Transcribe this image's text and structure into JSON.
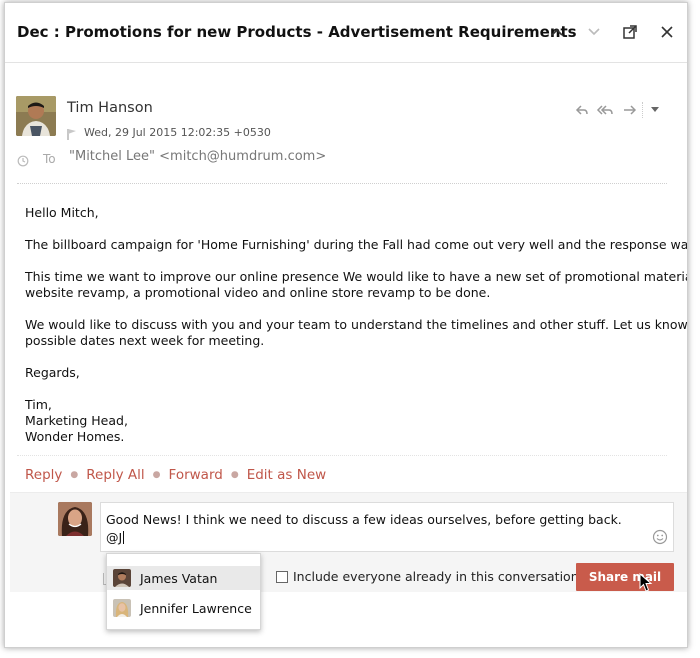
{
  "header": {
    "subject": "Dec : Promotions for new Products - Advertisement Requirements"
  },
  "message": {
    "sender_name": "Tim Hanson",
    "date": "Wed, 29 Jul 2015 12:02:35 +0530",
    "to_label": "To",
    "to_value": "\"Mitchel Lee\" <mitch@humdrum.com>",
    "body": {
      "greeting": "Hello Mitch,",
      "para1": "The billboard campaign for 'Home Furnishing' during the Fall had come out very well and the response was awesome.",
      "para2_line1": "This time we want to improve our online presence We would like to have a new set of promotional material, along with",
      "para2_line2": "website revamp, a promotional video and online store revamp to be done.",
      "para3_line1": "We would like to discuss with you and your team to understand the timelines and other stuff. Let us know the best",
      "para3_line2": "possible dates next week for meeting.",
      "regards": "Regards,",
      "sig_name": "Tim,",
      "sig_title": "Marketing Head,",
      "sig_company": "Wonder Homes."
    }
  },
  "actions": {
    "reply": "Reply",
    "reply_all": "Reply All",
    "forward": "Forward",
    "edit_as_new": "Edit as New"
  },
  "comment": {
    "line1": "Good News! I think we need to discuss a few ideas ourselves, before getting back.",
    "line2": "@J",
    "include_label": "Include everyone already in this conversation",
    "share_button": "Share mail"
  },
  "mentions": [
    {
      "name": "James Vatan"
    },
    {
      "name": "Jennifer Lawrence"
    }
  ],
  "icons": {
    "collapse": "chevron-up-icon",
    "next": "chevron-down-icon",
    "popout": "popout-icon",
    "close": "close-icon",
    "reply": "reply-icon",
    "reply_all": "reply-all-icon",
    "forward": "forward-icon",
    "more": "caret-down-icon",
    "flag": "flag-icon",
    "recipient": "recipient-icon",
    "smiley": "smiley-icon"
  },
  "colors": {
    "accent": "#c0574a",
    "share_button": "#c95b4b"
  }
}
